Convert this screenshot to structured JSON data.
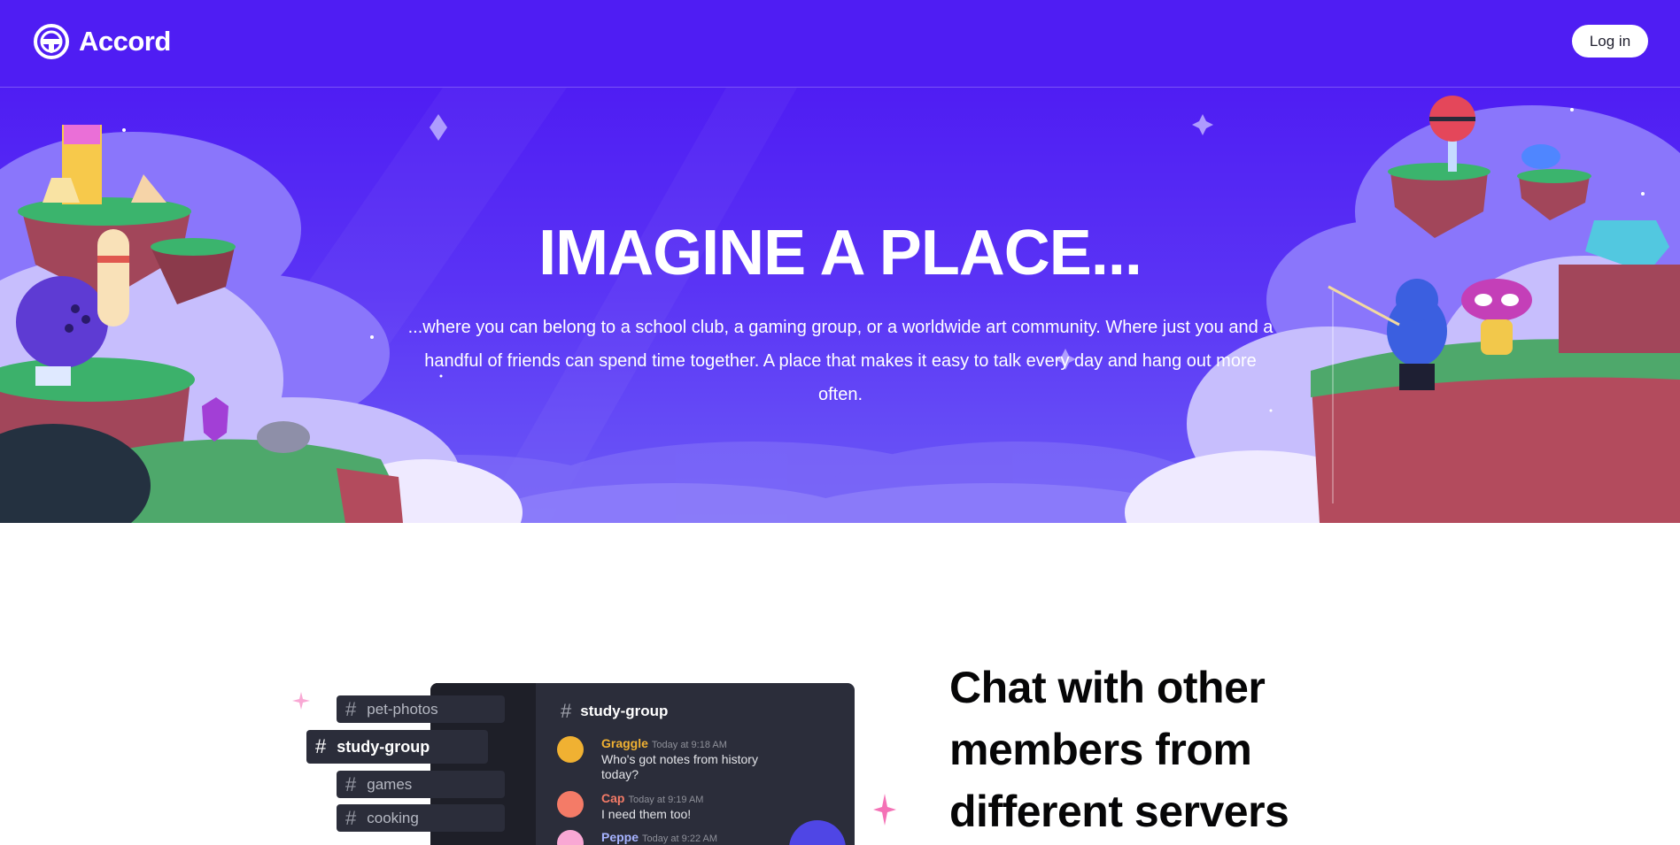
{
  "header": {
    "brand": "Accord",
    "login_label": "Log in"
  },
  "hero": {
    "title": "IMAGINE A PLACE...",
    "subtitle": "...where you can belong to a school club, a gaming group, or a worldwide art community. Where just you and a handful of friends can spend time together. A place that makes it easy to talk every day and hang out more often."
  },
  "feature": {
    "title": "Chat with other members from different servers"
  },
  "chat_preview": {
    "channels": [
      "pet-photos",
      "study-group",
      "games",
      "cooking"
    ],
    "active_channel": "study-group",
    "header": "study-group",
    "messages": [
      {
        "author": "Graggle",
        "time": "Today at 9:18 AM",
        "text": "Who's got notes from history today?",
        "color": "#f0b132"
      },
      {
        "author": "Cap",
        "time": "Today at 9:19 AM",
        "text": "I need them too!",
        "color": "#f47b67"
      },
      {
        "author": "Peppe",
        "time": "Today at 9:22 AM",
        "text": "",
        "color": "#a6b3ff"
      }
    ]
  },
  "colors": {
    "brand": "#4f1df3",
    "chat_bg": "#2b2d3a",
    "accent_pink": "#f472b6"
  }
}
